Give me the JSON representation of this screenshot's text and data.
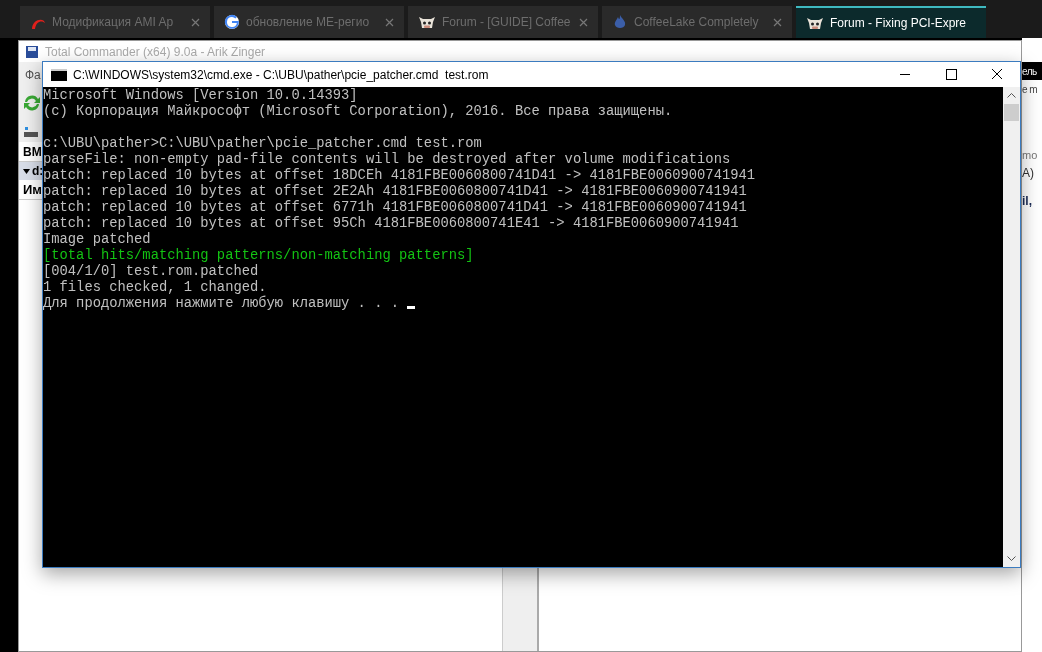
{
  "browser_tabs": [
    {
      "title": "Модификация AMI Ap",
      "selected": false
    },
    {
      "title": "обновление ME-регио",
      "selected": false
    },
    {
      "title": "Forum - [GUIDE] Coffee",
      "selected": false
    },
    {
      "title": "CoffeeLake Completely",
      "selected": false
    },
    {
      "title": "Forum - Fixing PCI-Expre",
      "selected": true
    }
  ],
  "background_window": {
    "title": "Total Commander (x64) 9.0a - Arik Zinger",
    "menu": "Фа",
    "drive": "ВМ",
    "path": "d:",
    "column": "Им"
  },
  "page_fragments": [
    "ель",
    "е m",
    "mo",
    "A)",
    "il,"
  ],
  "console": {
    "title": "C:\\WINDOWS\\system32\\cmd.exe - C:\\UBU\\pather\\pcie_patcher.cmd  test.rom",
    "lines": [
      {
        "text": "Microsoft Windows [Version 10.0.14393]",
        "kind": "normal"
      },
      {
        "text": "(c) Корпорация Майкрософт (Microsoft Corporation), 2016. Все права защищены.",
        "kind": "normal"
      },
      {
        "kind": "blank"
      },
      {
        "text": "c:\\UBU\\pather>C:\\UBU\\pather\\pcie_patcher.cmd test.rom",
        "kind": "normal"
      },
      {
        "text": "parseFile: non-empty pad-file contents will be destroyed after volume modifications",
        "kind": "normal"
      },
      {
        "text": "patch: replaced 10 bytes at offset 18DCEh 4181FBE0060800741D41 -> 4181FBE0060900741941",
        "kind": "normal"
      },
      {
        "text": "patch: replaced 10 bytes at offset 2E2Ah 4181FBE0060800741D41 -> 4181FBE0060900741941",
        "kind": "normal"
      },
      {
        "text": "patch: replaced 10 bytes at offset 6771h 4181FBE0060800741D41 -> 4181FBE0060900741941",
        "kind": "normal"
      },
      {
        "text": "patch: replaced 10 bytes at offset 95Ch 4181FBE0060800741E41 -> 4181FBE0060900741941",
        "kind": "normal"
      },
      {
        "text": "Image patched",
        "kind": "normal"
      },
      {
        "text": "[total hits/matching patterns/non-matching patterns]",
        "kind": "highlight"
      },
      {
        "text": "[004/1/0] test.rom.patched",
        "kind": "normal"
      },
      {
        "text": "1 files checked, 1 changed.",
        "kind": "normal"
      },
      {
        "text": "Для продолжения нажмите любую клавишу . . .",
        "kind": "prompt"
      }
    ]
  }
}
